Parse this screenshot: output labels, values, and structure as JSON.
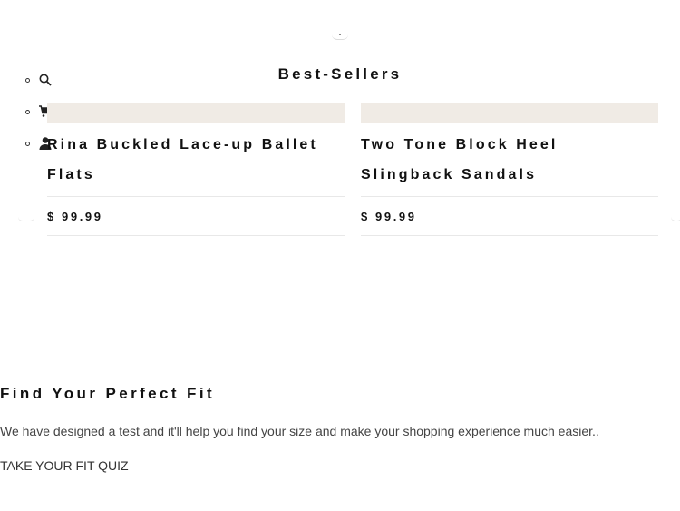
{
  "nav": {
    "icons": [
      {
        "icon": "search-icon"
      },
      {
        "icon": "cart-icon"
      },
      {
        "icon": "user-icon"
      }
    ]
  },
  "bestsellers": {
    "title": "Best-Sellers",
    "products": [
      {
        "name": "Rina Buckled Lace-up Ballet Flats",
        "price": "$ 99.99"
      },
      {
        "name": "Two Tone Block Heel Slingback Sandals",
        "price": "$ 99.99"
      }
    ]
  },
  "fit": {
    "title": "Find Your Perfect Fit",
    "description": "We have designed a test and it'll help you find your size and make your shopping experience much easier..",
    "link_label": "TAKE YOUR FIT QUIZ"
  },
  "colors": {
    "image_placeholder": "#f0ebe5",
    "text": "#111111",
    "rule": "#e8e8e8"
  }
}
